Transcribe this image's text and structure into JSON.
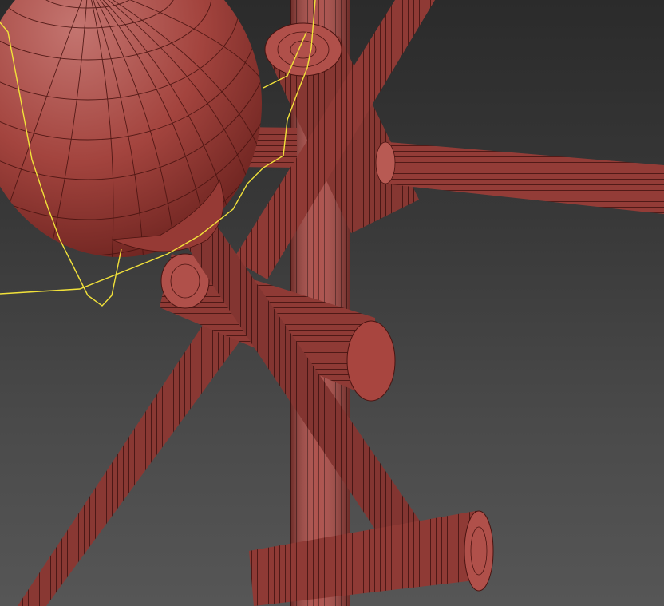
{
  "viewport": {
    "mode": "3d-perspective",
    "display": "wireframe-on-shaded",
    "colors": {
      "background_top": "#2b2b2b",
      "background_bottom": "#565656",
      "object_fill": "#a8453f",
      "object_shade": "#7c2c28",
      "object_highlight": "#c9706a",
      "wire": "#4a1411",
      "selection_outline": "#f2e23a"
    },
    "objects": [
      "sphere",
      "vertical-pole",
      "horizontal-arm",
      "right-arm",
      "small-cylinder-top",
      "diagonal-rod-right",
      "diagonal-rod-left",
      "center-tube",
      "foreground-rod",
      "bottom-cylinder"
    ],
    "selection": "sphere"
  }
}
